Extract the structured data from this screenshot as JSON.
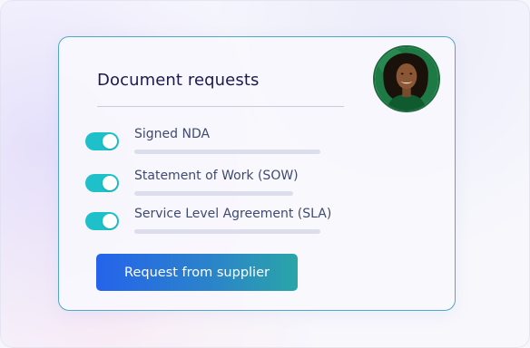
{
  "card": {
    "title": "Document requests",
    "avatar_icon": "person-avatar-icon",
    "requests": [
      {
        "label": "Signed NDA",
        "enabled": true
      },
      {
        "label": "Statement of Work (SOW)",
        "enabled": true
      },
      {
        "label": "Service Level Agreement (SLA)",
        "enabled": true
      }
    ],
    "cta_label": "Request from supplier"
  },
  "colors": {
    "accent_teal": "#1ec1c9",
    "button_gradient_start": "#2563eb",
    "button_gradient_end": "#2aa5a8",
    "card_border": "#4fa8c8",
    "title": "#1c1a4e",
    "label": "#3e4a6e"
  }
}
